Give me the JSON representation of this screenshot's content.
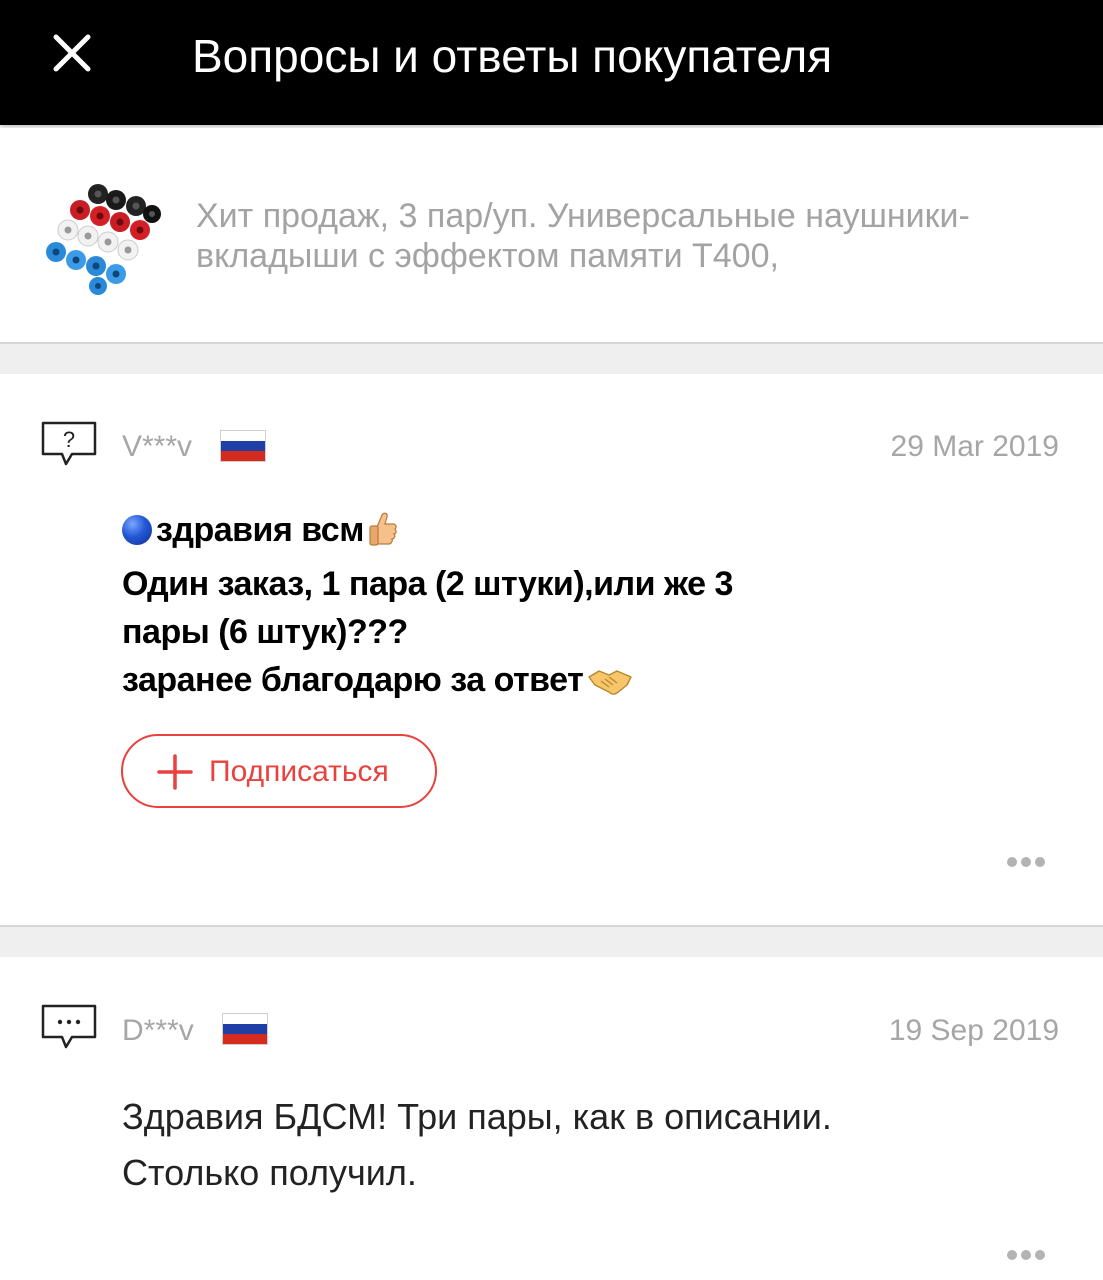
{
  "header": {
    "title": "Вопросы и ответы покупателя"
  },
  "product": {
    "title": "Хит продаж, 3 пар/уп. Универсальные наушники-вкладыши с эффектом памяти T400,"
  },
  "question": {
    "user": "V***v",
    "date": "29 Mar 2019",
    "lines": [
      "здравия всм",
      "Один заказ, 1 пара (2 штуки),или же 3",
      "пары (6 штук)???",
      "заранее благодарю за ответ"
    ],
    "subscribe_label": "Подписаться"
  },
  "answer": {
    "user": "D***v",
    "date": "19 Sep 2019",
    "lines": [
      "Здравия БДСМ! Три пары, как в описании.",
      "Столько получил."
    ]
  },
  "icons": {
    "close": "close-icon",
    "question": "question-bubble-icon",
    "answer": "answer-bubble-icon",
    "plus": "plus-icon",
    "more": "more-dots-icon",
    "flag": "russia-flag-icon"
  },
  "colors": {
    "header_bg": "#000000",
    "accent": "#e8413e",
    "muted_text": "#a6a6a6",
    "divider": "#efefef"
  }
}
